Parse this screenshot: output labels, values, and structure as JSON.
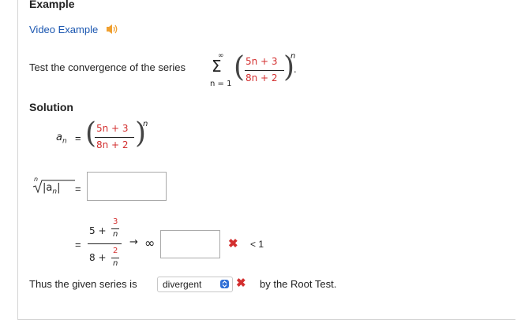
{
  "header": {
    "title": "Example",
    "video_link": "Video Example"
  },
  "question": {
    "prefix": "Test the convergence of the series",
    "sum_upper": "∞",
    "sum_lower": "n = 1",
    "numerator": "5n + 3",
    "denominator": "8n + 2",
    "exponent": "n",
    "period": "."
  },
  "solution": {
    "label": "Solution",
    "an_var": "a",
    "an_sub": "n",
    "equals": "=",
    "numerator": "5n + 3",
    "denominator": "8n + 2",
    "exponent": "n",
    "root_index": "n",
    "root_expr": "|a",
    "root_sub": "n",
    "root_close": "|",
    "root_answer": "",
    "limit_top_a": "5 +",
    "limit_top_num": "3",
    "limit_top_den": "n",
    "limit_bot_a": "8 +",
    "limit_bot_num": "2",
    "limit_bot_den": "n",
    "arrow": "→",
    "infinity": "∞",
    "limit_answer": "",
    "less_than": "< 1",
    "conclusion_prefix": "Thus the given series is",
    "conclusion_selected": "divergent",
    "conclusion_suffix": "by the Root Test.",
    "wrong_mark": "✖"
  },
  "colors": {
    "link": "#1a56b0",
    "incorrect": "#d32f2f",
    "select_accent": "#2f6fd6"
  },
  "icons": [
    "speaker-icon",
    "incorrect-x-icon",
    "select-updown-icon"
  ]
}
